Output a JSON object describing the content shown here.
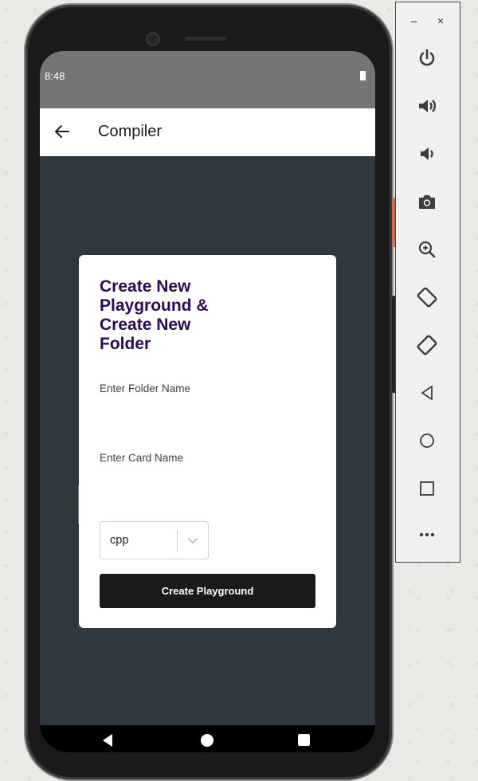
{
  "status_bar": {
    "time": "8:48"
  },
  "app_bar": {
    "title": "Compiler"
  },
  "dialog": {
    "title_lines": [
      "Create New",
      "Playground &",
      "Create New",
      "Folder"
    ],
    "folder_label": "Enter Folder Name",
    "card_label": "Enter Card Name",
    "language_value": "cpp",
    "create_button": "Create Playground"
  },
  "nav_bar": {
    "icons": [
      "back-triangle-icon",
      "home-circle-icon",
      "recents-square-icon"
    ]
  },
  "emulator_toolbar": {
    "minimize_label": "–",
    "close_label": "×",
    "tools": [
      "power-icon",
      "volume-up-icon",
      "volume-down-icon",
      "camera-icon",
      "zoom-icon",
      "rotate-left-icon",
      "rotate-right-icon",
      "back-icon",
      "home-icon",
      "overview-icon",
      "more-icon"
    ]
  },
  "colors": {
    "status_bar": "#757575",
    "content_bg": "#2f383d",
    "title_purple": "#2b0b58",
    "button_dark": "#1c191d",
    "toolbar_bg": "#f0f0f0"
  }
}
